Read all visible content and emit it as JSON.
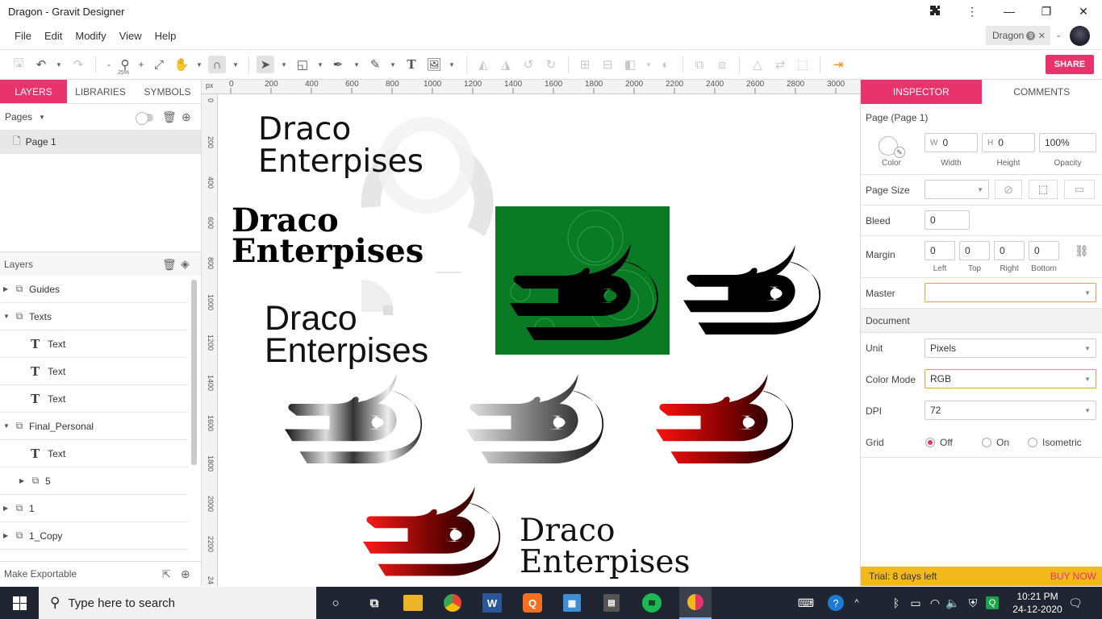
{
  "window": {
    "title": "Dragon - Gravit Designer"
  },
  "menu": [
    "File",
    "Edit",
    "Modify",
    "View",
    "Help"
  ],
  "doc_tab": {
    "label": "Dragon",
    "badge": "9"
  },
  "toolbar": {
    "zoom": "25%",
    "share_label": "SHARE"
  },
  "left_panel": {
    "tabs": [
      "LAYERS",
      "LIBRARIES",
      "SYMBOLS"
    ],
    "pages_label": "Pages",
    "pages": [
      "Page 1"
    ],
    "layers_label": "Layers",
    "layers": [
      {
        "name": "Guides",
        "kind": "group",
        "expanded": false
      },
      {
        "name": "Texts",
        "kind": "group",
        "expanded": true
      },
      {
        "name": "Text",
        "kind": "text"
      },
      {
        "name": "Text",
        "kind": "text"
      },
      {
        "name": "Text",
        "kind": "text"
      },
      {
        "name": "Final_Personal",
        "kind": "group",
        "expanded": true
      },
      {
        "name": "Text",
        "kind": "text"
      },
      {
        "name": "5",
        "kind": "group",
        "expanded": false
      },
      {
        "name": "1",
        "kind": "group",
        "expanded": false
      },
      {
        "name": "1_Copy",
        "kind": "group",
        "expanded": false
      }
    ],
    "make_exportable": "Make Exportable"
  },
  "rulers": {
    "unit": "px",
    "top": [
      "0",
      "200",
      "400",
      "600",
      "800",
      "1000",
      "1200",
      "1400",
      "1600",
      "1800",
      "2000",
      "2200",
      "2400",
      "2600",
      "2800",
      "3000"
    ],
    "left": [
      "0",
      "200",
      "400",
      "600",
      "800",
      "1000",
      "1200",
      "1400",
      "1600",
      "1800",
      "2000",
      "2200",
      "24"
    ]
  },
  "canvas": {
    "wordmarks": [
      {
        "line1": "Draco",
        "line2": "Enterpises"
      },
      {
        "line1": "Draco",
        "line2": "Enterpises"
      },
      {
        "line1": "Draco",
        "line2": "Enterpises"
      },
      {
        "line1": "Draco",
        "line2": "Enterpises"
      }
    ],
    "colors": {
      "green_bg": "#0b7a24",
      "red": "#e10e0e",
      "dark_red": "#3a0000"
    }
  },
  "inspector": {
    "tabs": [
      "INSPECTOR",
      "COMMENTS"
    ],
    "header": "Page (Page 1)",
    "color_label": "Color",
    "width": {
      "prefix": "W",
      "value": "0",
      "label": "Width"
    },
    "height": {
      "prefix": "H",
      "value": "0",
      "label": "Height"
    },
    "opacity": {
      "value": "100%",
      "label": "Opacity"
    },
    "page_size_label": "Page Size",
    "bleed_label": "Bleed",
    "bleed_value": "0",
    "margin_label": "Margin",
    "margins": [
      {
        "value": "0",
        "label": "Left"
      },
      {
        "value": "0",
        "label": "Top"
      },
      {
        "value": "0",
        "label": "Right"
      },
      {
        "value": "0",
        "label": "Bottom"
      }
    ],
    "master_label": "Master",
    "document_label": "Document",
    "unit_label": "Unit",
    "unit_value": "Pixels",
    "color_mode_label": "Color Mode",
    "color_mode_value": "RGB",
    "dpi_label": "DPI",
    "dpi_value": "72",
    "grid_label": "Grid",
    "grid_options": [
      "Off",
      "On",
      "Isometric"
    ],
    "grid_selected": "Off",
    "trial_text": "Trial: 8 days left",
    "buy_now": "BUY NOW"
  },
  "taskbar": {
    "search_placeholder": "Type here to search",
    "time": "10:21 PM",
    "date": "24-12-2020"
  },
  "accent": "#e8336d"
}
